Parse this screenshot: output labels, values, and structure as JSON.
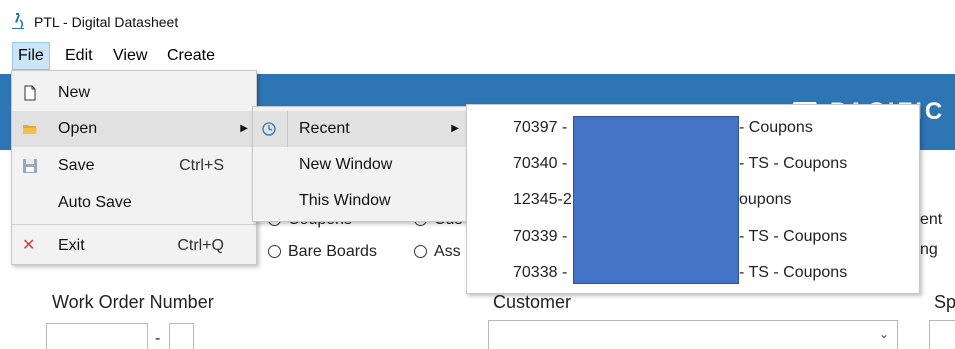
{
  "window": {
    "title": "PTL - Digital Datasheet"
  },
  "menubar": {
    "file": "File",
    "edit": "Edit",
    "view": "View",
    "create": "Create"
  },
  "banner": {
    "logo_text": "PACIFIC T",
    "accent": "#2e75b6"
  },
  "file_menu": {
    "items": [
      {
        "label": "New",
        "shortcut": "",
        "icon": "new-file-icon"
      },
      {
        "label": "Open",
        "shortcut": "",
        "icon": "folder-open-icon"
      },
      {
        "label": "Save",
        "shortcut": "Ctrl+S",
        "icon": "save-icon"
      },
      {
        "label": "Auto Save",
        "shortcut": ""
      },
      {
        "label": "Exit",
        "shortcut": "Ctrl+Q",
        "icon": "close-icon"
      }
    ]
  },
  "open_menu": {
    "items": [
      {
        "label": "Recent",
        "icon": "clock-icon"
      },
      {
        "label": "New Window"
      },
      {
        "label": "This Window"
      }
    ]
  },
  "recent_menu": {
    "items": [
      {
        "left": "70397 -",
        "right": "- Coupons"
      },
      {
        "left": "70340 -",
        "right": "- TS - Coupons"
      },
      {
        "left": "12345-2",
        "right": "oupons"
      },
      {
        "left": "70339 -",
        "right": "- TS - Coupons"
      },
      {
        "left": "70338 -",
        "right": "- TS - Coupons"
      }
    ],
    "redaction_color": "#4472c4"
  },
  "form": {
    "radios": {
      "coupons": "Coupons",
      "bare_boards": "Bare Boards",
      "cus": "Cus",
      "ass": "Ass",
      "ent": "ent",
      "ng": "ng"
    },
    "labels": {
      "work_order": "Work Order Number",
      "customer": "Customer",
      "sp": "Sp"
    },
    "wo_dash": "-"
  }
}
